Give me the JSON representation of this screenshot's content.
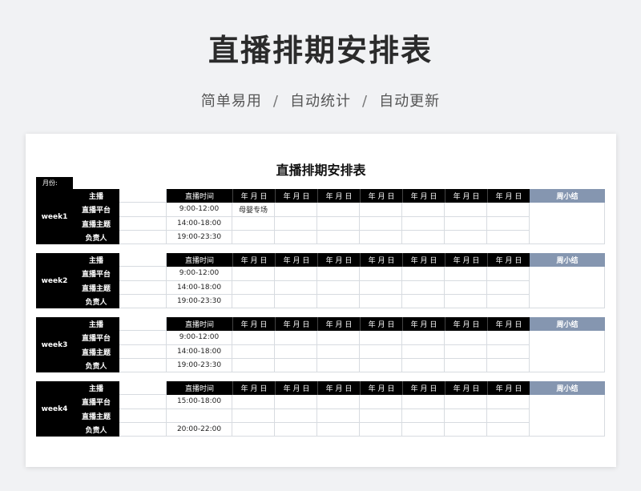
{
  "hero": {
    "title": "直播排期安排表",
    "subtitle_parts": [
      "简单易用",
      "自动统计",
      "自动更新"
    ],
    "separator": "/"
  },
  "sheet": {
    "title": "直播排期安排表",
    "month_label": "月份:"
  },
  "columns": {
    "role": "主播",
    "time": "直播时间",
    "date": "年 月 日",
    "summary": "周小结",
    "row_labels": [
      "直播平台",
      "直播主题",
      "负责人"
    ]
  },
  "colors": {
    "header_black": "#000000",
    "summary_blue": "#8596b0",
    "background": "#f1f2f4"
  },
  "weeks": [
    {
      "label": "week1",
      "times": [
        "9:00-12:00",
        "14:00-18:00",
        "19:00-23:30"
      ],
      "first_day_entries": [
        "母婴专场",
        "",
        ""
      ]
    },
    {
      "label": "week2",
      "times": [
        "9:00-12:00",
        "14:00-18:00",
        "19:00-23:30"
      ],
      "first_day_entries": [
        "",
        "",
        ""
      ]
    },
    {
      "label": "week3",
      "times": [
        "9:00-12:00",
        "14:00-18:00",
        "19:00-23:30"
      ],
      "first_day_entries": [
        "",
        "",
        ""
      ]
    },
    {
      "label": "week4",
      "times": [
        "15:00-18:00",
        "",
        "20:00-22:00"
      ],
      "first_day_entries": [
        "",
        "",
        ""
      ]
    }
  ]
}
